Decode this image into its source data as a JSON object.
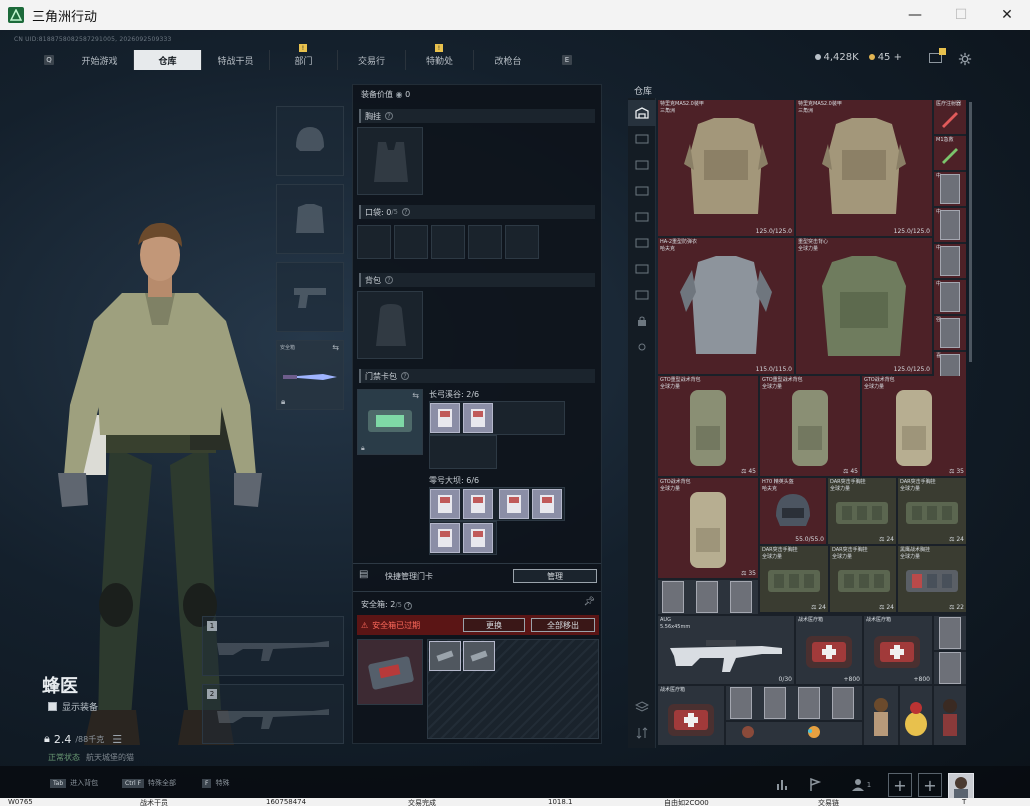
{
  "window": {
    "title": "三角洲行动",
    "minimize": "—",
    "maximize": "☐",
    "close": "✕"
  },
  "uid_text": "CN UID:8188758082587291005, 2026092509333",
  "nav": {
    "left_key": "Q",
    "right_key": "E",
    "tabs": [
      {
        "label": "开始游戏",
        "active": false,
        "notice": false
      },
      {
        "label": "仓库",
        "active": true,
        "notice": false
      },
      {
        "label": "特战干员",
        "active": false,
        "notice": false
      },
      {
        "label": "部门",
        "active": false,
        "notice": true
      },
      {
        "label": "交易行",
        "active": false,
        "notice": false
      },
      {
        "label": "特勤处",
        "active": false,
        "notice": true
      },
      {
        "label": "改枪台",
        "active": false,
        "notice": false
      }
    ],
    "notice_mark": "!"
  },
  "hud": {
    "currency1": "4,428K",
    "currency2": "45",
    "currency2_plus": "+",
    "colors": {
      "c1": "#b9c1c9",
      "c2": "#e2b552"
    }
  },
  "character": {
    "name": "蜂医",
    "show_equipment": "显示装备",
    "weight": "2.4",
    "weight_max": "/88千克",
    "status": "正常状态",
    "status_sub": "航天城堡的猫"
  },
  "slots": {
    "secure_label": "安全箱",
    "weapon1": "1",
    "weapon2": "2"
  },
  "middle": {
    "equip_value_label": "装备价值",
    "equip_value": "0",
    "sections": {
      "chest": "胸挂",
      "pockets": "口袋:",
      "pockets_count": "0",
      "pockets_max": "/5",
      "backpack": "背包",
      "keycard": "门禁卡包"
    },
    "keycard_groups": [
      {
        "label": "长弓溪谷:",
        "count": "2/6"
      },
      {
        "label": "零号大坝:",
        "count": "6/6"
      }
    ],
    "quick_manage": "快捷管理门卡",
    "manage_btn": "管理",
    "safebox_label": "安全箱:",
    "safebox_count": "2",
    "safebox_max": "/5",
    "safebox_expired": "安全箱已过期",
    "replace_btn": "更换",
    "remove_all_btn": "全部移出"
  },
  "warehouse": {
    "title": "仓库",
    "items": [
      {
        "name": "特里克MAS2.0装甲",
        "sub": "三角洲",
        "durability": "125.0/125.0",
        "color": "red"
      },
      {
        "name": "特里克MAS2.0装甲",
        "sub": "三角洲",
        "durability": "125.0/125.0",
        "color": "red"
      },
      {
        "name": "HA-2重型防弹衣",
        "sub": "哈夫克",
        "durability": "115.0/115.0",
        "color": "red"
      },
      {
        "name": "重型突击背心",
        "sub": "全球力量",
        "durability": "125.0/125.0",
        "color": "red"
      },
      {
        "name": "GTO重型战术背包",
        "sub": "全球力量",
        "count": "45",
        "color": "red"
      },
      {
        "name": "GTO重型战术背包",
        "sub": "全球力量",
        "count": "45",
        "color": "red"
      },
      {
        "name": "GTO战术背包",
        "sub": "全球力量",
        "count": "35",
        "color": "red"
      },
      {
        "name": "GTO战术背包",
        "sub": "全球力量",
        "count": "35",
        "color": "red"
      },
      {
        "name": "H70 精英头盔",
        "sub": "哈夫克",
        "durability": "55.0/55.0",
        "color": "red"
      },
      {
        "name": "DAR突击手胸挂",
        "sub": "全球力量",
        "count": "24",
        "color": "grn"
      },
      {
        "name": "DAR突击手胸挂",
        "sub": "全球力量",
        "count": "24",
        "color": "grn"
      },
      {
        "name": "DAR突击手胸挂",
        "sub": "全球力量",
        "count": "24",
        "color": "grn"
      },
      {
        "name": "DAR突击手胸挂",
        "sub": "全球力量",
        "count": "24",
        "color": "grn"
      },
      {
        "name": "黑鹰战术胸挂",
        "sub": "全球力量",
        "count": "22",
        "color": "grn"
      },
      {
        "name": "AUG",
        "sub": "5.56x45mm",
        "ammo": "0/30",
        "color": "gry"
      },
      {
        "name": "战术医疗箱",
        "count": "800",
        "color": "gry"
      },
      {
        "name": "战术医疗箱",
        "count": "800",
        "color": "gry"
      },
      {
        "name": "战术医疗箱",
        "color": "gry"
      }
    ],
    "side_items": [
      "医疗注射器",
      "M1急救",
      "中",
      "中",
      "中",
      "中",
      "中",
      "中",
      "强",
      "喜",
      "中",
      "中"
    ]
  },
  "bottom": {
    "hints": [
      {
        "key": "Tab",
        "label": "进入背包"
      },
      {
        "key": "Ctrl F",
        "label": "特殊全部"
      },
      {
        "key": "F",
        "label": "特殊"
      }
    ],
    "friend_count": "1"
  },
  "taskbar": [
    "W0765",
    "战术干员",
    "160758474",
    "交易完成",
    "1018.1",
    "自由如2CO00",
    "交易链",
    "T"
  ]
}
